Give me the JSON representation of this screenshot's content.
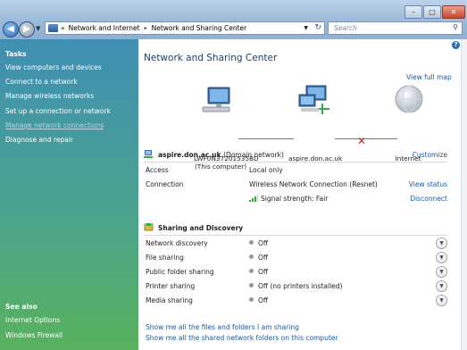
{
  "window": {
    "buttons": {
      "minimize": "–",
      "maximize": "□",
      "close": "✕"
    }
  },
  "address": {
    "prefix": "«",
    "crumbs": [
      "Network and Internet",
      "Network and Sharing Center"
    ],
    "separator": "▸"
  },
  "search": {
    "placeholder": "Search"
  },
  "sidebar": {
    "tasks_heading": "Tasks",
    "tasks": [
      "View computers and devices",
      "Connect to a network",
      "Manage wireless networks",
      "Set up a connection or network",
      "Manage network connections",
      "Diagnose and repair"
    ],
    "see_also_heading": "See also",
    "see_also": [
      "Internet Options",
      "Windows Firewall"
    ]
  },
  "main": {
    "title": "Network and Sharing Center",
    "view_full_map": "View full map",
    "map": {
      "computer_name": "LWF0N37201535BD",
      "computer_sub": "(This computer)",
      "network_name": "aspire.don.ac.uk",
      "internet": "Internet"
    },
    "network_section": {
      "name": "aspire.don.ac.uk",
      "type": "(Domain network)",
      "customize": "Customize",
      "rows": [
        {
          "label": "Access",
          "value": "Local only",
          "action": ""
        },
        {
          "label": "Connection",
          "value": "Wireless Network Connection (Resnet)",
          "action": "View status"
        },
        {
          "label": "",
          "value": "Signal strength: Fair",
          "action": "Disconnect"
        }
      ]
    },
    "sharing_section": {
      "title": "Sharing and Discovery",
      "rows": [
        {
          "label": "Network discovery",
          "value": "Off"
        },
        {
          "label": "File sharing",
          "value": "Off"
        },
        {
          "label": "Public folder sharing",
          "value": "Off"
        },
        {
          "label": "Printer sharing",
          "value": "Off (no printers installed)"
        },
        {
          "label": "Media sharing",
          "value": "Off"
        }
      ]
    },
    "bottom_links": [
      "Show me all the files and folders I am sharing",
      "Show me all the shared network folders on this computer"
    ]
  },
  "colors": {
    "link": "#1a5aa0",
    "sidebar_top": "#3f8fb4",
    "sidebar_bottom": "#58b25d",
    "disconnected_cross": "#c0392b"
  }
}
